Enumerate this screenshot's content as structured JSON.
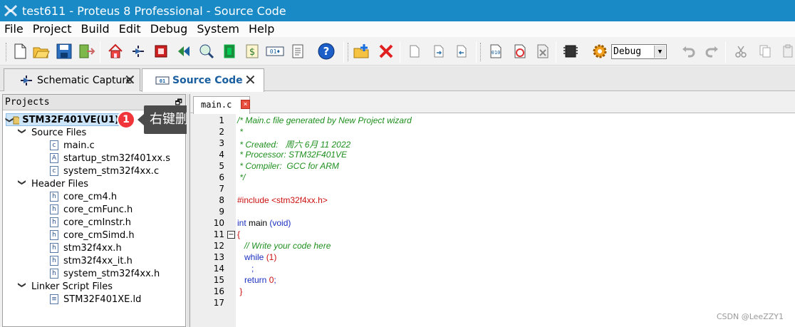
{
  "window": {
    "title": "test611 - Proteus 8 Professional - Source Code"
  },
  "menu": [
    "File",
    "Project",
    "Build",
    "Edit",
    "Debug",
    "System",
    "Help"
  ],
  "toolbar": {
    "debug_select": "Debug"
  },
  "tabs": [
    {
      "label": "Schematic Capture",
      "close": "✕"
    },
    {
      "label": "Source Code",
      "close": "✕"
    }
  ],
  "projects": {
    "header": "Projects",
    "pin": "🗗",
    "root": "STM32F401VE(U1)",
    "groups": [
      {
        "label": "Source Files",
        "files": [
          {
            "name": "main.c",
            "type": "c"
          },
          {
            "name": "startup_stm32f401xx.s",
            "type": "A"
          },
          {
            "name": "system_stm32f4xx.c",
            "type": "c"
          }
        ]
      },
      {
        "label": "Header Files",
        "files": [
          {
            "name": "core_cm4.h",
            "type": "h"
          },
          {
            "name": "core_cmFunc.h",
            "type": "h"
          },
          {
            "name": "core_cmInstr.h",
            "type": "h"
          },
          {
            "name": "core_cmSimd.h",
            "type": "h"
          },
          {
            "name": "stm32f4xx.h",
            "type": "h"
          },
          {
            "name": "stm32f4xx_it.h",
            "type": "h"
          },
          {
            "name": "system_stm32f4xx.h",
            "type": "h"
          }
        ]
      },
      {
        "label": "Linker Script Files",
        "files": [
          {
            "name": "STM32F401XE.ld",
            "type": "ld"
          }
        ]
      }
    ]
  },
  "annotation": {
    "badge": "1",
    "tooltip": "右键删除项目"
  },
  "editor": {
    "tab_label": "main.c",
    "tab_close": "×",
    "lines": [
      {
        "n": "1",
        "parts": [
          [
            "comment",
            "/* Main.c file generated by New Project wizard"
          ]
        ]
      },
      {
        "n": "2",
        "parts": [
          [
            "comment",
            " *"
          ]
        ]
      },
      {
        "n": "3",
        "parts": [
          [
            "comment",
            " * Created:   周六 6月 11 2022"
          ]
        ]
      },
      {
        "n": "4",
        "parts": [
          [
            "comment",
            " * Processor: STM32F401VE"
          ]
        ]
      },
      {
        "n": "5",
        "parts": [
          [
            "comment",
            " * Compiler:  GCC for ARM"
          ]
        ]
      },
      {
        "n": "6",
        "parts": [
          [
            "comment",
            " */"
          ]
        ]
      },
      {
        "n": "7",
        "parts": []
      },
      {
        "n": "8",
        "parts": [
          [
            "pre",
            "#include <stm32f4xx.h>"
          ]
        ]
      },
      {
        "n": "9",
        "parts": []
      },
      {
        "n": "10",
        "parts": [
          [
            "kw",
            "int"
          ],
          [
            "plain",
            " main "
          ],
          [
            "kw",
            "(void)"
          ]
        ]
      },
      {
        "n": "11",
        "parts": [
          [
            "pre",
            "{"
          ]
        ],
        "fold": "−"
      },
      {
        "n": "12",
        "parts": [
          [
            "comment",
            "   // Write your code here"
          ]
        ]
      },
      {
        "n": "13",
        "parts": [
          [
            "kw",
            "   while "
          ],
          [
            "num",
            "(1)"
          ]
        ]
      },
      {
        "n": "14",
        "parts": [
          [
            "kw",
            "      ;"
          ]
        ]
      },
      {
        "n": "15",
        "parts": [
          [
            "kw",
            "   return "
          ],
          [
            "num",
            "0"
          ],
          [
            "kw",
            ";"
          ]
        ]
      },
      {
        "n": "16",
        "parts": [
          [
            "pre",
            " }"
          ]
        ]
      },
      {
        "n": "17",
        "parts": []
      }
    ]
  },
  "watermark": "CSDN @LeeZZY1"
}
